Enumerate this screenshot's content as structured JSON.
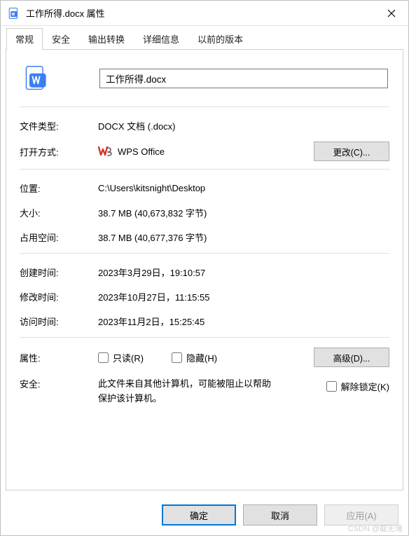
{
  "window": {
    "title": "工作所得.docx 属性",
    "close": "✕"
  },
  "tabs": {
    "items": [
      {
        "label": "常规",
        "active": true
      },
      {
        "label": "安全",
        "active": false
      },
      {
        "label": "输出转换",
        "active": false
      },
      {
        "label": "详细信息",
        "active": false
      },
      {
        "label": "以前的版本",
        "active": false
      }
    ]
  },
  "file": {
    "name": "工作所得.docx"
  },
  "labels": {
    "filetype": "文件类型:",
    "opens_with": "打开方式:",
    "change_btn": "更改(C)...",
    "location": "位置:",
    "size": "大小:",
    "size_on_disk": "占用空间:",
    "created": "创建时间:",
    "modified": "修改时间:",
    "accessed": "访问时间:",
    "attributes": "属性:",
    "readonly": "只读(R)",
    "hidden": "隐藏(H)",
    "advanced_btn": "高级(D)...",
    "security": "安全:",
    "unblock": "解除锁定(K)"
  },
  "values": {
    "filetype": "DOCX 文档 (.docx)",
    "opens_with": "WPS Office",
    "location": "C:\\Users\\kitsnight\\Desktop",
    "size": "38.7 MB (40,673,832 字节)",
    "size_on_disk": "38.7 MB (40,677,376 字节)",
    "created": "2023年3月29日，19:10:57",
    "modified": "2023年10月27日，11:15:55",
    "accessed": "2023年11月2日，15:25:45",
    "security_msg": "此文件来自其他计算机，可能被阻止以帮助保护该计算机。"
  },
  "checkboxes": {
    "readonly": false,
    "hidden": false,
    "unblock": false
  },
  "footer": {
    "ok": "确定",
    "cancel": "取消",
    "apply": "应用(A)"
  },
  "watermark": "CSDN @靛无境",
  "colors": {
    "accent": "#0078d7",
    "wps_red": "#d9362a",
    "doc_blue": "#3b7ef3"
  }
}
